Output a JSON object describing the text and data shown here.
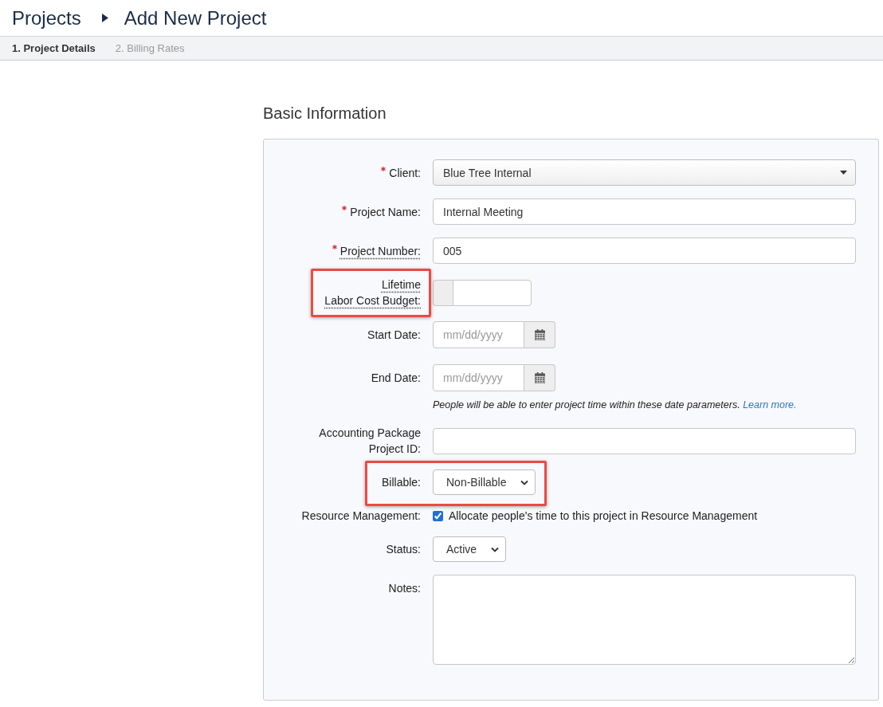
{
  "breadcrumb": {
    "parent": "Projects",
    "current": "Add New Project"
  },
  "steps": [
    {
      "label": "1. Project Details",
      "selected": true
    },
    {
      "label": "2. Billing Rates",
      "selected": false
    }
  ],
  "section_title": "Basic Information",
  "fields": [
    {
      "kind": "dropdown",
      "label": "Client:",
      "required": true,
      "tooltip": false,
      "label_highlighted": false,
      "row_highlighted": false,
      "value": "Blue Tree Internal"
    },
    {
      "kind": "text",
      "label": "Project Name:",
      "required": true,
      "tooltip": false,
      "label_highlighted": false,
      "row_highlighted": false,
      "value": "Internal Meeting"
    },
    {
      "kind": "text",
      "label": "Project Number:",
      "required": true,
      "tooltip": true,
      "label_highlighted": false,
      "row_highlighted": false,
      "value": "005"
    },
    {
      "kind": "addon_input",
      "label": "Lifetime\nLabor Cost Budget:",
      "required": false,
      "tooltip": true,
      "label_highlighted": true,
      "row_highlighted": false
    },
    {
      "kind": "date",
      "label": "Start Date:",
      "required": false,
      "tooltip": false,
      "label_highlighted": false,
      "row_highlighted": false,
      "placeholder": "mm/dd/yyyy"
    },
    {
      "kind": "date",
      "label": "End Date:",
      "required": false,
      "tooltip": false,
      "label_highlighted": false,
      "row_highlighted": false,
      "placeholder": "mm/dd/yyyy",
      "help": "People will be able to enter project time within these date parameters.",
      "help_link": "Learn more."
    },
    {
      "kind": "text",
      "label": "Accounting Package\nProject ID:",
      "required": false,
      "tooltip": false,
      "label_highlighted": false,
      "row_highlighted": false
    },
    {
      "kind": "select",
      "label": "Billable:",
      "required": false,
      "tooltip": false,
      "label_highlighted": false,
      "row_highlighted": true,
      "value": "Non-Billable"
    },
    {
      "kind": "checkbox",
      "label": "Resource Management:",
      "required": false,
      "tooltip": false,
      "label_highlighted": false,
      "row_highlighted": false,
      "checked": true,
      "text": "Allocate people's time to this project in Resource Management"
    },
    {
      "kind": "select",
      "label": "Status:",
      "required": false,
      "tooltip": false,
      "label_highlighted": false,
      "row_highlighted": false,
      "value": "Active"
    },
    {
      "kind": "textarea",
      "label": "Notes:",
      "required": false,
      "tooltip": false,
      "label_highlighted": false,
      "row_highlighted": false
    }
  ]
}
